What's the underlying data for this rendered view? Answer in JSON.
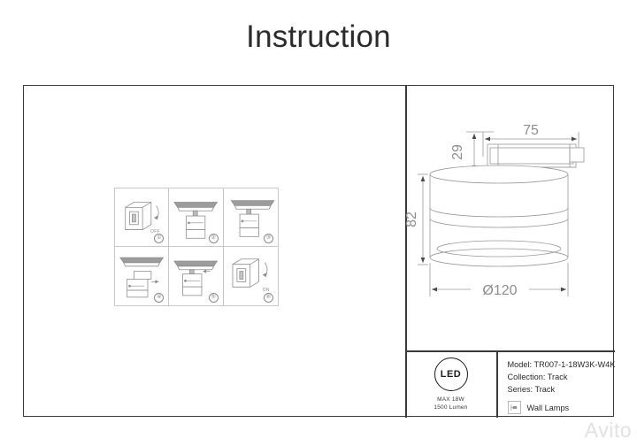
{
  "page": {
    "title": "Instruction"
  },
  "instructions": {
    "steps": [
      {
        "num": "①",
        "label": "OFF",
        "type": "switch-off"
      },
      {
        "num": "②",
        "label": "",
        "type": "mount-track"
      },
      {
        "num": "③",
        "label": "",
        "type": "attach-fixture"
      },
      {
        "num": "④",
        "label": "",
        "type": "detach-fixture"
      },
      {
        "num": "⑤",
        "label": "",
        "type": "rotate-fixture"
      },
      {
        "num": "⑥",
        "label": "ON",
        "type": "switch-on"
      }
    ]
  },
  "drawing": {
    "dim_width": "75",
    "dim_height_top": "29",
    "dim_height_body": "82",
    "dim_diameter": "ø120"
  },
  "led_badge": {
    "mark": "LED",
    "max_power": "MAX 18W",
    "lumen": "1500 Lumen"
  },
  "product": {
    "model": "Model: TR007-1-18W3K-W4K",
    "collection": "Collection: Track",
    "series": "Series: Track",
    "category": "Wall Lamps"
  },
  "watermark": {
    "text": "Avito"
  },
  "colors": {
    "frame": "#3a3a3a",
    "line": "#c9c9c9",
    "text": "#2b2b2b",
    "drawing": "#9a9a9a"
  }
}
